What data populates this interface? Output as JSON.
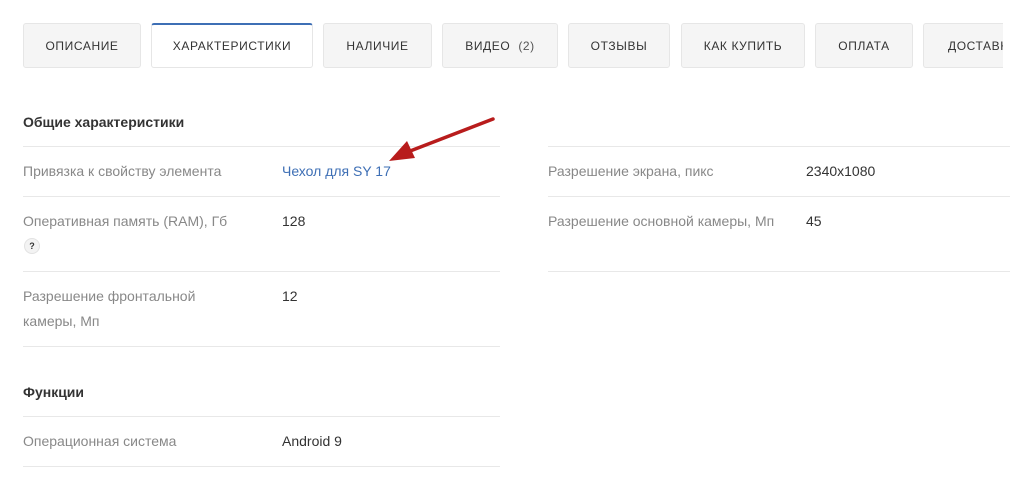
{
  "tabs": [
    {
      "label": "ОПИСАНИЕ"
    },
    {
      "label": "ХАРАКТЕРИСТИКИ",
      "active": true
    },
    {
      "label": "НАЛИЧИЕ"
    },
    {
      "label": "ВИДЕО",
      "count": "(2)"
    },
    {
      "label": "ОТЗЫВЫ"
    },
    {
      "label": "КАК КУПИТЬ"
    },
    {
      "label": "ОПЛАТА"
    },
    {
      "label": "ДОСТАВКА"
    }
  ],
  "sections": [
    {
      "title": "Общие характеристики",
      "left": [
        {
          "name": "Привязка к свойству элемента",
          "value": "Чехол для SY 17",
          "is_link": true
        },
        {
          "name": "Оперативная память (RAM), Гб",
          "value": "128",
          "hint": "?"
        },
        {
          "name": "Разрешение фронтальной камеры, Мп",
          "value": "12"
        }
      ],
      "right": [
        {
          "name": "Разрешение экрана, пикс",
          "value": "2340x1080"
        },
        {
          "name": "Разрешение основной камеры, Мп",
          "value": "45"
        }
      ]
    },
    {
      "title": "Функции",
      "left": [
        {
          "name": "Операционная система",
          "value": "Android 9"
        }
      ]
    }
  ],
  "colors": {
    "accent": "#3e6fb5",
    "annotation_arrow": "#b81c1c"
  }
}
